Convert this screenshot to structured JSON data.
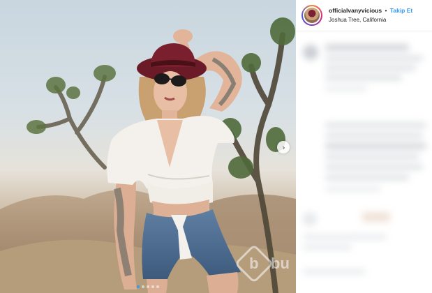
{
  "post": {
    "username": "officialvanyvicious",
    "separator": "•",
    "follow_label": "Takip Et",
    "location": "Joshua Tree, California"
  },
  "carousel": {
    "next_icon": "chevron-right-icon",
    "slide_count": 5,
    "active_index": 0
  },
  "watermark": {
    "logo_letter": "b",
    "text": "bu"
  },
  "colors": {
    "follow": "#3897f0",
    "hat": "#7a1f2e",
    "sky": "#c9d6df"
  }
}
